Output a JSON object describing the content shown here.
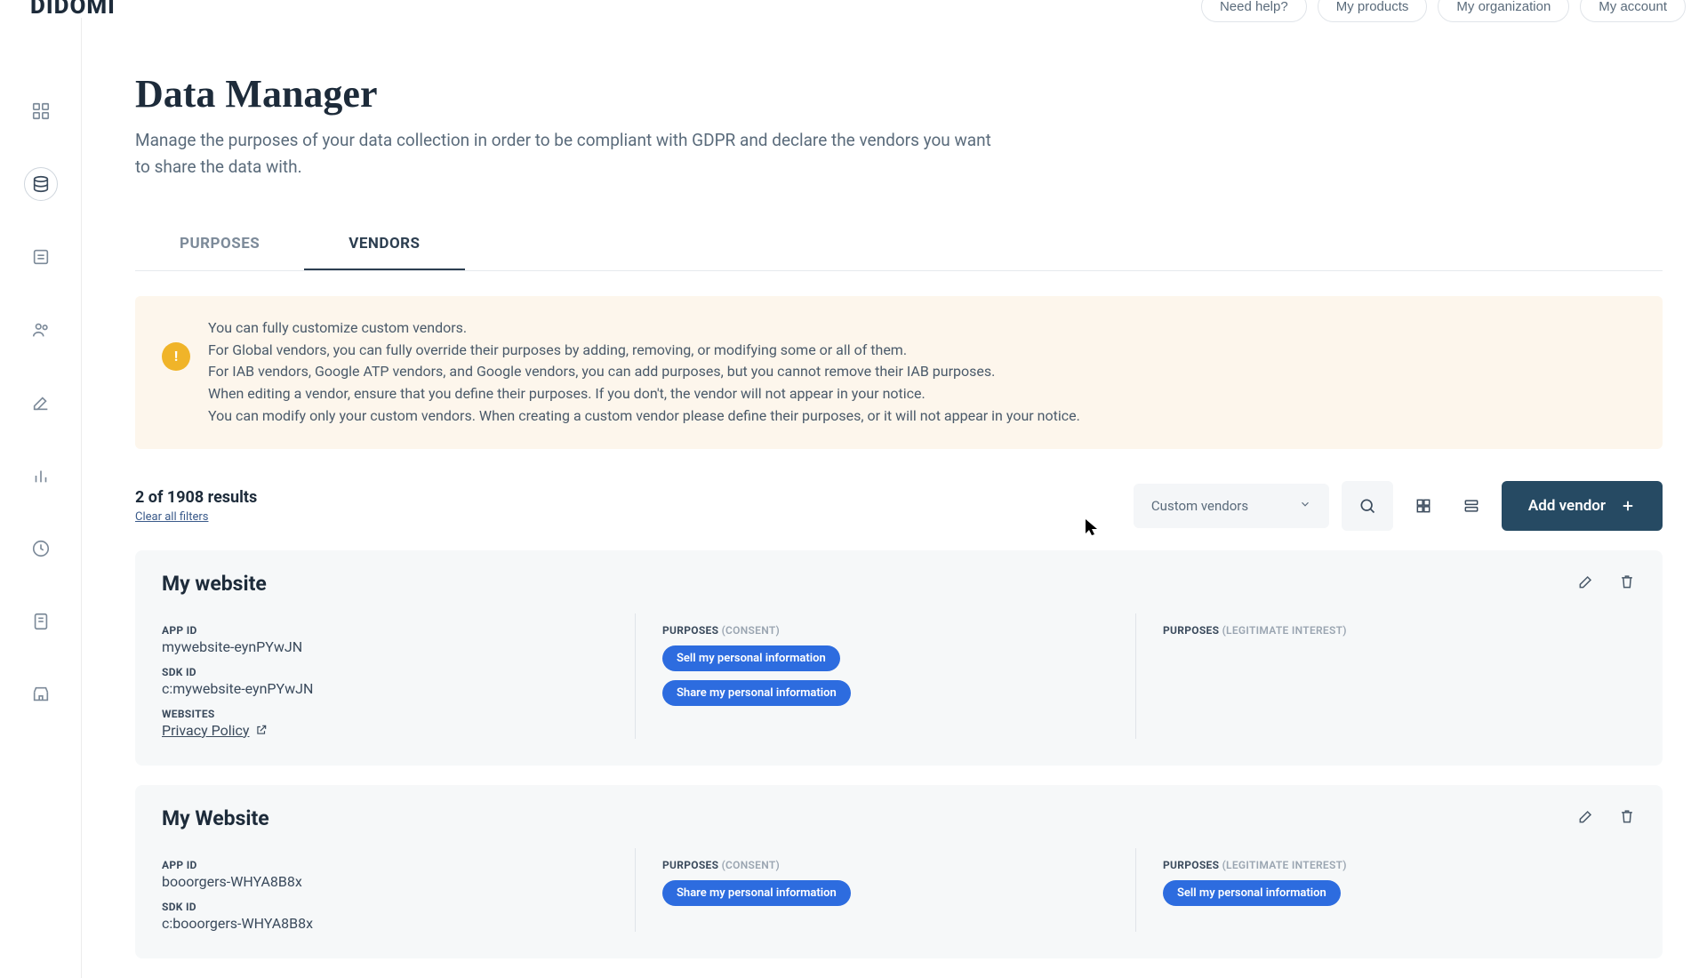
{
  "brand": "DIDOMI",
  "header": {
    "help": "Need help?",
    "products": "My products",
    "org": "My organization",
    "account": "My account"
  },
  "page": {
    "title": "Data Manager",
    "description": "Manage the purposes of your data collection in order to be compliant with GDPR and declare the vendors you want to share the data with."
  },
  "tabs": {
    "purposes": "PURPOSES",
    "vendors": "VENDORS"
  },
  "info": {
    "l1": "You can fully customize custom vendors.",
    "l2": "For Global vendors, you can fully override their purposes by adding, removing, or modifying some or all of them.",
    "l3": "For IAB vendors, Google ATP vendors, and Google vendors, you can add purposes, but you cannot remove their IAB purposes.",
    "l4": "When editing a vendor, ensure that you define their purposes. If you don't, the vendor will not appear in your notice.",
    "l5": "You can modify only your custom vendors. When creating a custom vendor please define their purposes, or it will not appear in your notice."
  },
  "toolbar": {
    "results": "2 of 1908 results",
    "clear": "Clear all filters",
    "filter": "Custom vendors",
    "add": "Add vendor"
  },
  "labels": {
    "appid": "APP ID",
    "sdkid": "SDK ID",
    "websites": "WEBSITES",
    "purposes": "PURPOSES",
    "consent": "(CONSENT)",
    "legit": "(LEGITIMATE INTEREST)",
    "privacy": "Privacy Policy"
  },
  "cards": [
    {
      "title": "My website",
      "appid": "mywebsite-eynPYwJN",
      "sdkid": "c:mywebsite-eynPYwJN",
      "consent": [
        "Sell my personal information",
        "Share my personal information"
      ],
      "legit": []
    },
    {
      "title": "My Website",
      "appid": "booorgers-WHYA8B8x",
      "sdkid": "c:booorgers-WHYA8B8x",
      "consent": [
        "Share my personal information"
      ],
      "legit": [
        "Sell my personal information"
      ]
    }
  ]
}
